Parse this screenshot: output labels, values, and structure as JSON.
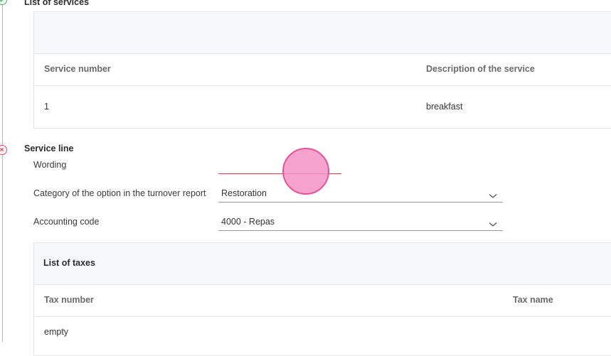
{
  "services_section": {
    "title": "List of services",
    "status": "valid",
    "columns": [
      "Service number",
      "Description of the service"
    ],
    "rows": [
      {
        "number": "1",
        "description": "breakfast"
      }
    ]
  },
  "service_line": {
    "title": "Service line",
    "status": "error",
    "wording_label": "Wording",
    "wording_value": "",
    "category_label": "Category of the option in the turnover report",
    "category_value": "Restoration",
    "accounting_label": "Accounting code",
    "accounting_value": "4000 - Repas"
  },
  "taxes": {
    "title": "List of taxes",
    "columns": [
      "Tax number",
      "Tax name"
    ],
    "empty_text": "empty"
  },
  "colors": {
    "valid": "#3cb552",
    "error": "#e0465c",
    "cursor": "#f392c3"
  }
}
